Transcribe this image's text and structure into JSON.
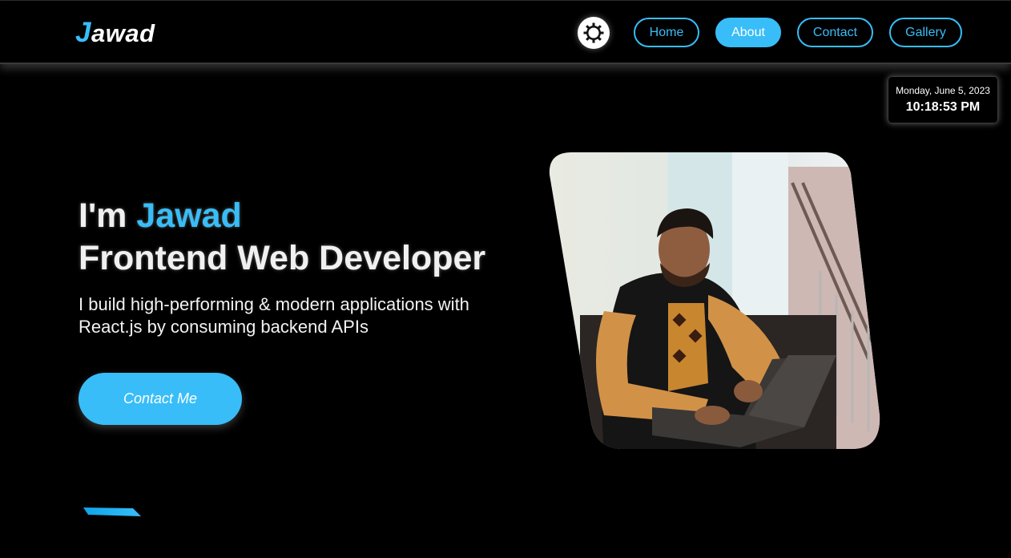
{
  "brand": {
    "logo_first": "J",
    "logo_rest": "awad"
  },
  "nav": {
    "theme_toggle_icon": "sun-icon",
    "links": [
      {
        "label": "Home",
        "active": false
      },
      {
        "label": "About",
        "active": true
      },
      {
        "label": "Contact",
        "active": false
      },
      {
        "label": "Gallery",
        "active": false
      }
    ]
  },
  "clock": {
    "date": "Monday, June 5, 2023",
    "time": "10:18:53 PM"
  },
  "hero": {
    "greeting": "I'm ",
    "name": "Jawad",
    "role": "Frontend Web Developer",
    "description": "I build high-performing & modern applications with React.js by consuming backend APIs",
    "cta": "Contact Me"
  },
  "colors": {
    "accent": "#38bdf8",
    "background": "#000000",
    "text": "#ffffff"
  }
}
